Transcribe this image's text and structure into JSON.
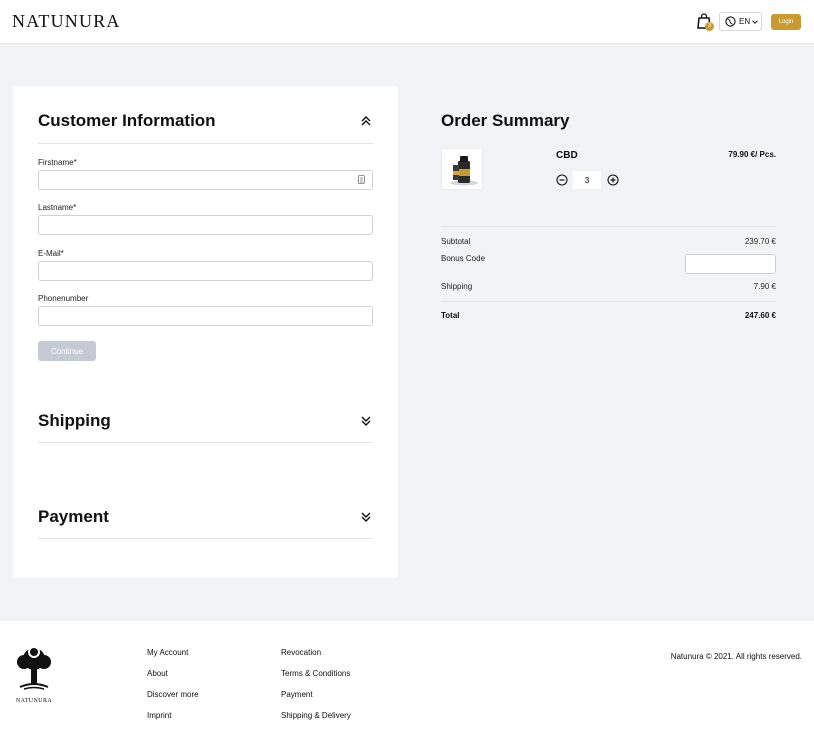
{
  "header": {
    "logo_text": "NATUNURA",
    "cart_count": "3",
    "language": "EN",
    "login_label": "Login"
  },
  "customer_info": {
    "title": "Customer Information",
    "fields": [
      {
        "label": "Firstname",
        "required_mark": "*",
        "value": ""
      },
      {
        "label": "Lastname",
        "required_mark": "*",
        "value": ""
      },
      {
        "label": "E-Mail",
        "required_mark": "*",
        "value": ""
      },
      {
        "label": "Phonenumber",
        "required_mark": "",
        "value": ""
      }
    ],
    "continue_label": "Continue"
  },
  "shipping": {
    "title": "Shipping"
  },
  "payment": {
    "title": "Payment"
  },
  "order_summary": {
    "title": "Order Summary",
    "product": {
      "name": "CBD",
      "price": "79.90 €/ Pcs.",
      "quantity": "3"
    },
    "subtotal_label": "Subtotal",
    "subtotal_value": "239.70 €",
    "bonus_label": "Bonus Code",
    "bonus_value": "",
    "shipping_label": "Shipping",
    "shipping_value": "7.90 €",
    "total_label": "Total",
    "total_value": "247.60 €"
  },
  "footer": {
    "logo_text": "NATUNURA",
    "col1": [
      "My Account",
      "About",
      "Discover more",
      "Imprint"
    ],
    "col2": [
      "Revocation",
      "Terms & Conditions",
      "Payment",
      "Shipping & Delivery"
    ],
    "copyright": "Natunura © 2021. All rights reserved."
  },
  "colors": {
    "accent": "#c99a2e",
    "page_bg": "#f2f3f5",
    "disabled_button": "#c5cad3"
  },
  "icons": [
    "bag-icon",
    "globe-icon",
    "chevron-down-icon",
    "double-chevron-up-icon",
    "double-chevron-down-icon",
    "minus-circle-icon",
    "plus-circle-icon",
    "contact-card-icon",
    "tree-logo-icon"
  ]
}
